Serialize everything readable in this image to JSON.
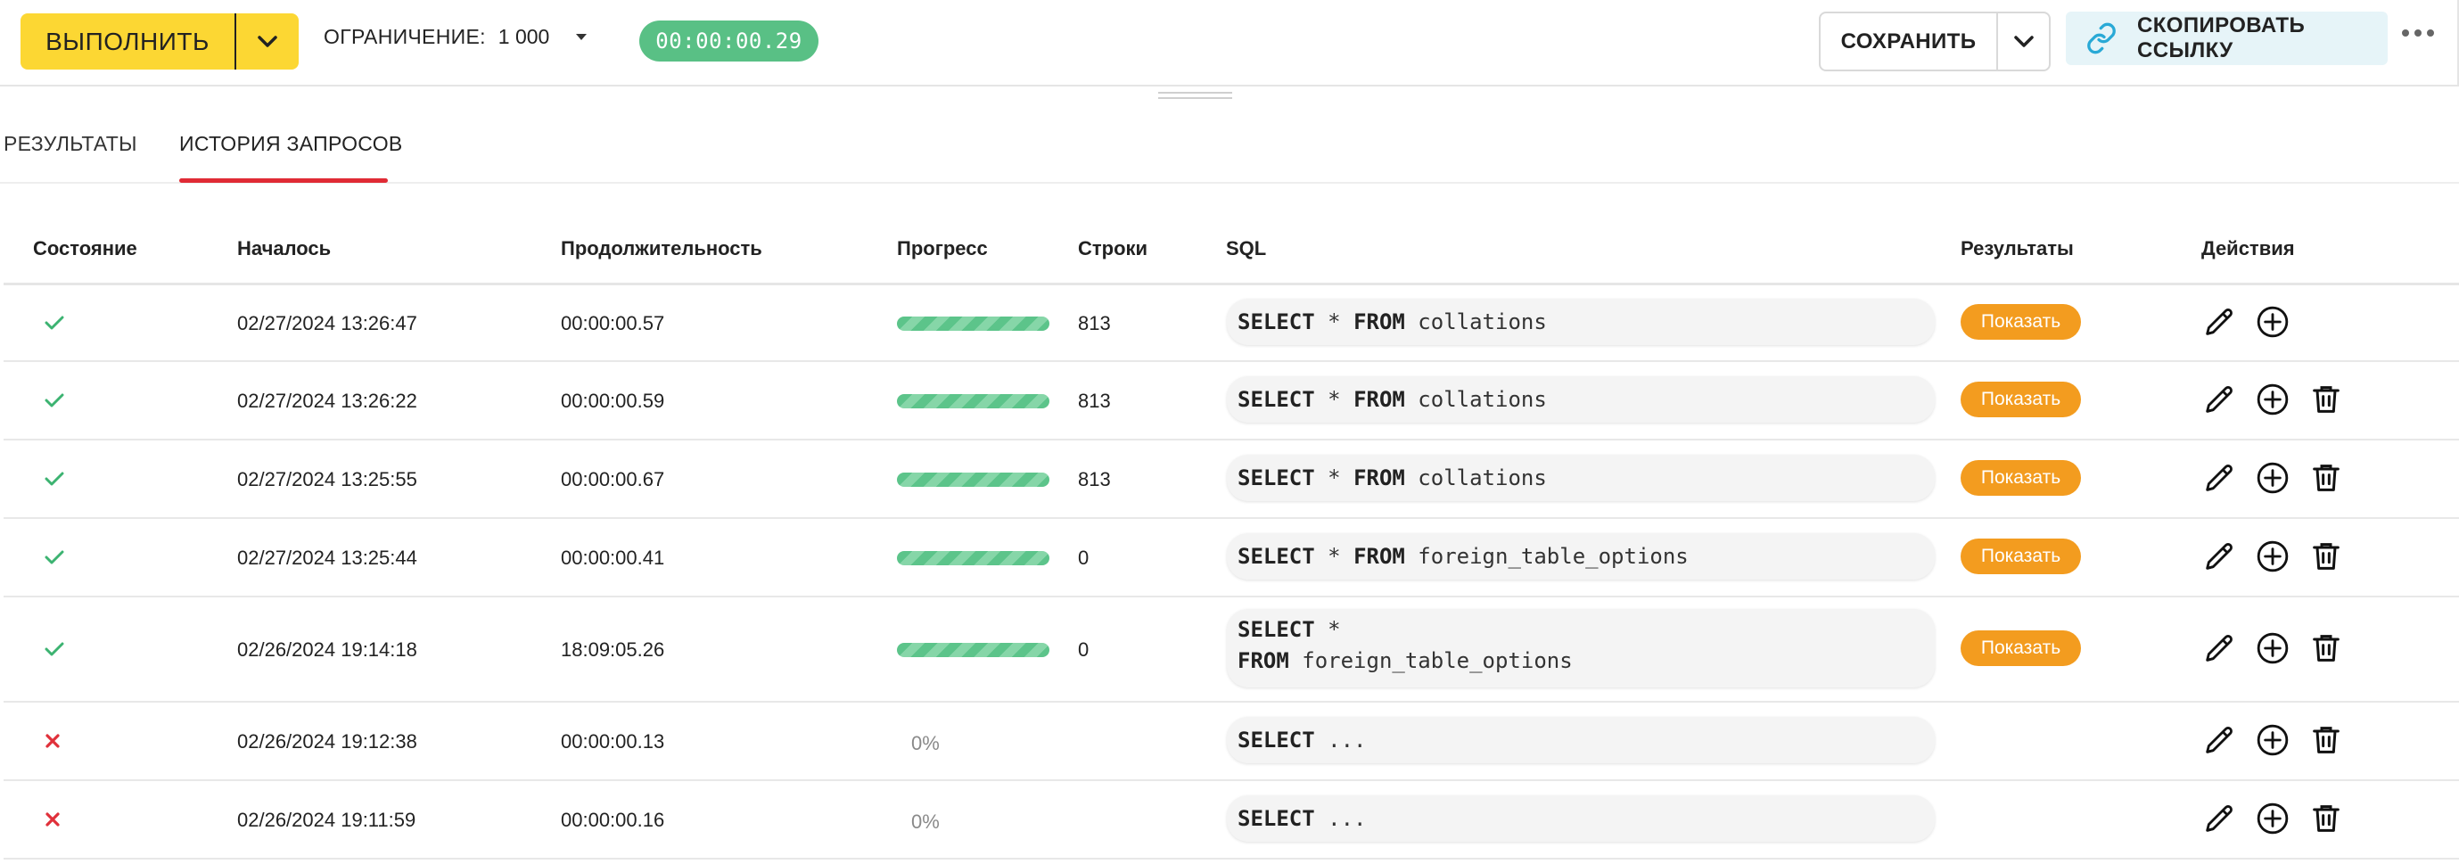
{
  "toolbar": {
    "run_label": "ВЫПОЛНИТЬ",
    "limit_label": "ОГРАНИЧЕНИЕ:",
    "limit_value": "1 000",
    "timer": "00:00:00.29",
    "save_label": "СОХРАНИТЬ",
    "copy_link_label": "СКОПИРОВАТЬ ССЫЛКУ"
  },
  "tabs": [
    {
      "label": "РЕЗУЛЬТАТЫ",
      "active": false
    },
    {
      "label": "ИСТОРИЯ ЗАПРОСОВ",
      "active": true
    }
  ],
  "table": {
    "headers": {
      "state": "Состояние",
      "started": "Началось",
      "duration": "Продолжительность",
      "progress": "Прогресс",
      "rows": "Строки",
      "sql": "SQL",
      "results": "Результаты",
      "actions": "Действия"
    },
    "show_label": "Показать",
    "rows": [
      {
        "status": "success",
        "started": "02/27/2024 13:26:47",
        "duration": "00:00:00.57",
        "progress": 1.0,
        "rows": "813",
        "sql_lines": [
          [
            "SELECT",
            " * ",
            "FROM",
            " collations"
          ]
        ],
        "has_results": true,
        "can_delete": false
      },
      {
        "status": "success",
        "started": "02/27/2024 13:26:22",
        "duration": "00:00:00.59",
        "progress": 1.0,
        "rows": "813",
        "sql_lines": [
          [
            "SELECT",
            " * ",
            "FROM",
            " collations"
          ]
        ],
        "has_results": true,
        "can_delete": true
      },
      {
        "status": "success",
        "started": "02/27/2024 13:25:55",
        "duration": "00:00:00.67",
        "progress": 1.0,
        "rows": "813",
        "sql_lines": [
          [
            "SELECT",
            " * ",
            "FROM",
            " collations"
          ]
        ],
        "has_results": true,
        "can_delete": true
      },
      {
        "status": "success",
        "started": "02/27/2024 13:25:44",
        "duration": "00:00:00.41",
        "progress": 1.0,
        "rows": "0",
        "sql_lines": [
          [
            "SELECT",
            " * ",
            "FROM",
            " foreign_table_options"
          ]
        ],
        "has_results": true,
        "can_delete": true
      },
      {
        "status": "success",
        "started": "02/26/2024 19:14:18",
        "duration": "18:09:05.26",
        "progress": 1.0,
        "rows": "0",
        "sql_lines": [
          [
            "SELECT",
            " *",
            "",
            ""
          ],
          [
            "",
            "",
            "FROM",
            " foreign_table_options"
          ]
        ],
        "has_results": true,
        "can_delete": true
      },
      {
        "status": "failed",
        "started": "02/26/2024 19:12:38",
        "duration": "00:00:00.13",
        "progress_text": "0%",
        "rows": "",
        "sql_lines": [
          [
            "SELECT",
            " ...",
            "",
            ""
          ]
        ],
        "has_results": false,
        "can_delete": true
      },
      {
        "status": "failed",
        "started": "02/26/2024 19:11:59",
        "duration": "00:00:00.16",
        "progress_text": "0%",
        "rows": "",
        "sql_lines": [
          [
            "SELECT",
            " ...",
            "",
            ""
          ]
        ],
        "has_results": false,
        "can_delete": true
      }
    ]
  },
  "colors": {
    "run_button": "#fcd733",
    "timer": "#59c085",
    "tab_underline": "#e02b35",
    "success": "#3cb371",
    "failed": "#e0303a",
    "show_button": "#f39c1f",
    "copy_button_bg": "#e6f4f8",
    "link_icon": "#29a9d6"
  },
  "icons": {
    "run_dropdown": "chevron-down-icon",
    "limit_dropdown": "caret-down-icon",
    "save_dropdown": "chevron-down-icon",
    "copy_link": "link-icon",
    "more": "more-horizontal-icon",
    "success": "check-icon",
    "failed": "cross-icon",
    "edit": "pencil-icon",
    "add": "plus-circle-icon",
    "delete": "trash-icon"
  }
}
